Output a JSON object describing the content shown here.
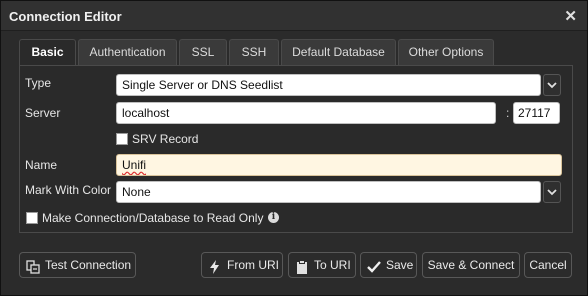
{
  "dialog": {
    "title": "Connection Editor"
  },
  "tabs": [
    {
      "label": "Basic"
    },
    {
      "label": "Authentication"
    },
    {
      "label": "SSL"
    },
    {
      "label": "SSH"
    },
    {
      "label": "Default Database"
    },
    {
      "label": "Other Options"
    }
  ],
  "form": {
    "type_label": "Type",
    "type_value": "Single Server or DNS Seedlist",
    "server_label": "Server",
    "server_value": "localhost",
    "colon": ":",
    "port_value": "27117",
    "srv_label": "SRV Record",
    "srv_checked": false,
    "name_label": "Name",
    "name_value": "Unifi",
    "color_label": "Mark With Color",
    "color_value": "None",
    "readonly_label": "Make Connection/Database to Read Only",
    "readonly_checked": false
  },
  "buttons": {
    "test": "Test Connection",
    "from_uri": "From URI",
    "to_uri": "To URI",
    "save": "Save",
    "save_connect": "Save & Connect",
    "cancel": "Cancel"
  },
  "icons": {
    "close": "close-icon",
    "dropdown": "chevron-down-icon",
    "info": "info-icon",
    "test": "test-connection-icon",
    "from_uri": "lightning-icon",
    "to_uri": "clipboard-icon",
    "save": "checkmark-icon"
  },
  "colors": {
    "background": "#2b2b2b",
    "name_highlight": "#fff6e2"
  }
}
